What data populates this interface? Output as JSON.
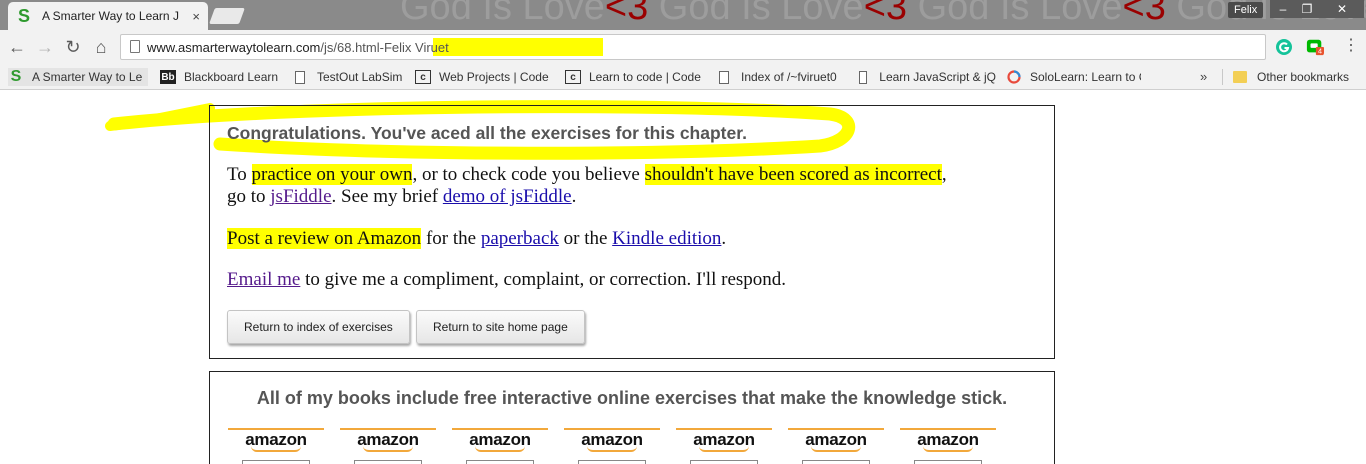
{
  "browser": {
    "tab_title": "A Smarter Way to Learn J",
    "tab_favicon": "S",
    "tab_close": "×",
    "profile_name": "Felix",
    "wallpaper_text": [
      "God Is Love",
      "<3",
      " God Is Love",
      "<3",
      " God Is Love",
      "<3",
      " God Is Love",
      "<3",
      " Go"
    ],
    "window_controls": {
      "minimize": "‒",
      "restore": "❐",
      "close": "✕"
    },
    "nav": {
      "back": "←",
      "forward": "→",
      "reload": "↻",
      "home": "⌂"
    },
    "url_host": "www.asmarterwaytolearn.com",
    "url_path": "/js/68.html-Felix Viruet",
    "extension_badge": "4",
    "menu": "⋮",
    "bookmarks": [
      {
        "label": "A Smarter Way to Le",
        "icon": "smarter-way-icon"
      },
      {
        "label": "Blackboard Learn",
        "icon": "blackboard-icon"
      },
      {
        "label": "TestOut LabSim",
        "icon": "page-icon"
      },
      {
        "label": "Web Projects | Code",
        "icon": "codecademy-icon"
      },
      {
        "label": "Learn to code | Code",
        "icon": "codecademy-icon"
      },
      {
        "label": "Index of /~fviruet0",
        "icon": "page-icon"
      },
      {
        "label": "Learn JavaScript & jQ",
        "icon": "page-icon"
      },
      {
        "label": "SoloLearn: Learn to C",
        "icon": "sololearn-icon"
      }
    ],
    "bookmarks_overflow": "»",
    "other_bookmarks": "Other bookmarks"
  },
  "page": {
    "congrats": "Congratulations. You've aced all the exercises for this chapter.",
    "p1": {
      "a": "To ",
      "b": "practice on your own",
      "c": ", or to check code you believe ",
      "d": "shouldn't have been scored as incorrect",
      "e": ",",
      "f": "go to ",
      "g": "jsFiddle",
      "h": ". See my brief ",
      "i": "demo of jsFiddle",
      "j": "."
    },
    "p2": {
      "a": "Post a review on Amazon",
      "b": " for the ",
      "c": "paperback",
      "d": " or the ",
      "e": "Kindle edition",
      "f": "."
    },
    "p3": {
      "a": "Email me",
      "b": " to give me a compliment, complaint, or correction. I'll respond."
    },
    "buttons": {
      "index": "Return to index of exercises",
      "home": "Return to site home page"
    },
    "books_title": "All of my books include free interactive online exercises that make the knowledge stick.",
    "amazon_label": "amazon"
  },
  "colors": {
    "highlight": "#ffff00",
    "link": "#1a0dab",
    "visited_link": "#551a8b",
    "amazon_orange": "#f2a83b"
  }
}
